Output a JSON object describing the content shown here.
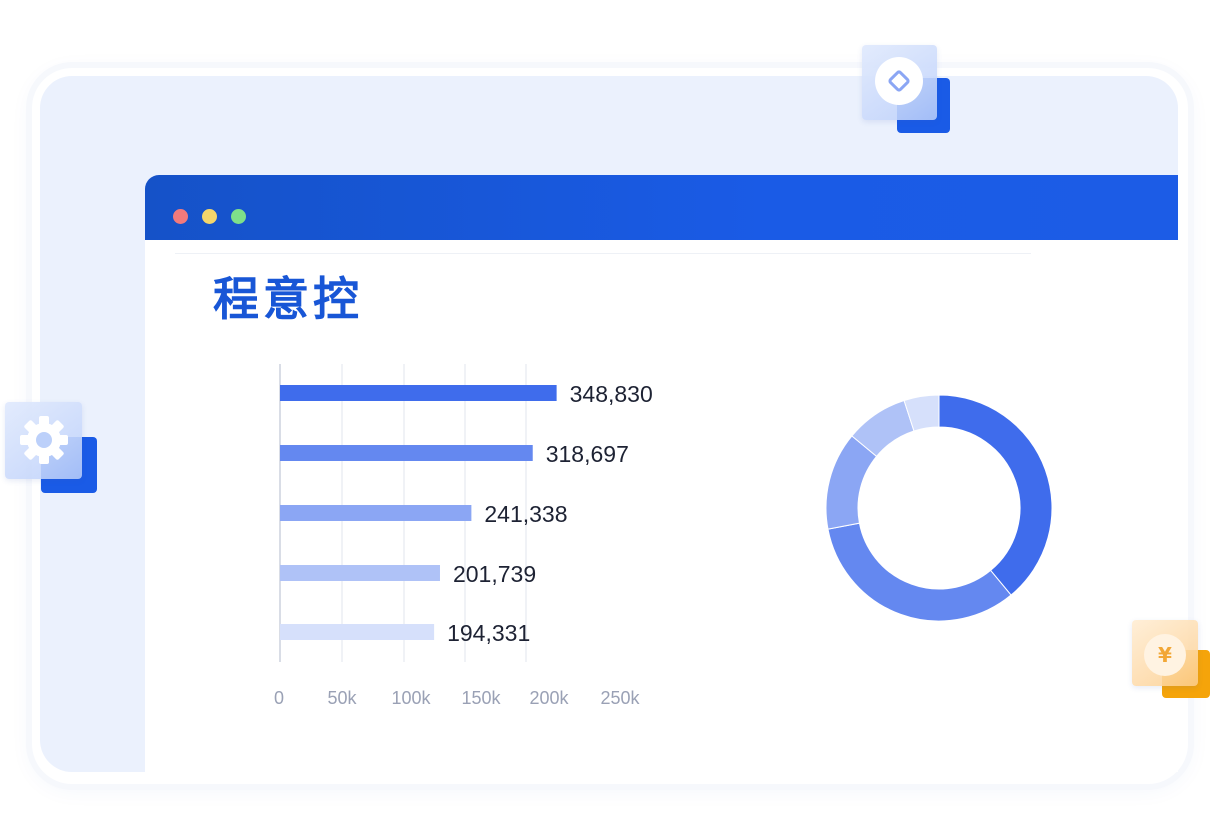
{
  "app": {
    "title": "程意控"
  },
  "colors": {
    "accent": "#1a5be6",
    "bar_colors": [
      "#3f6cec",
      "#6488f0",
      "#8ba6f4",
      "#afc2f7",
      "#d6e0fb"
    ],
    "donut_colors": [
      "#3f6cec",
      "#6488f0",
      "#8ba6f4",
      "#afc2f7",
      "#d6e0fb"
    ]
  },
  "window_controls": [
    "close-dot",
    "minimize-dot",
    "maximize-dot"
  ],
  "decorations": {
    "top_tile_icon": "diamond-icon",
    "left_tile_icon": "gear-icon",
    "right_tile_icon": "yuan-icon",
    "right_tile_symbol": "¥"
  },
  "chart_data": [
    {
      "type": "bar",
      "orientation": "horizontal",
      "values": [
        348830,
        318697,
        241338,
        201739,
        194331
      ],
      "value_labels": [
        "348,830",
        "318,697",
        "241,338",
        "201,739",
        "194,331"
      ],
      "x_ticks": [
        "0",
        "50k",
        "100k",
        "150k",
        "200k",
        "250k"
      ],
      "xlim": [
        0,
        250000
      ],
      "grid": true
    },
    {
      "type": "pie",
      "donut": true,
      "values": [
        39,
        33,
        14,
        9,
        5
      ]
    }
  ]
}
